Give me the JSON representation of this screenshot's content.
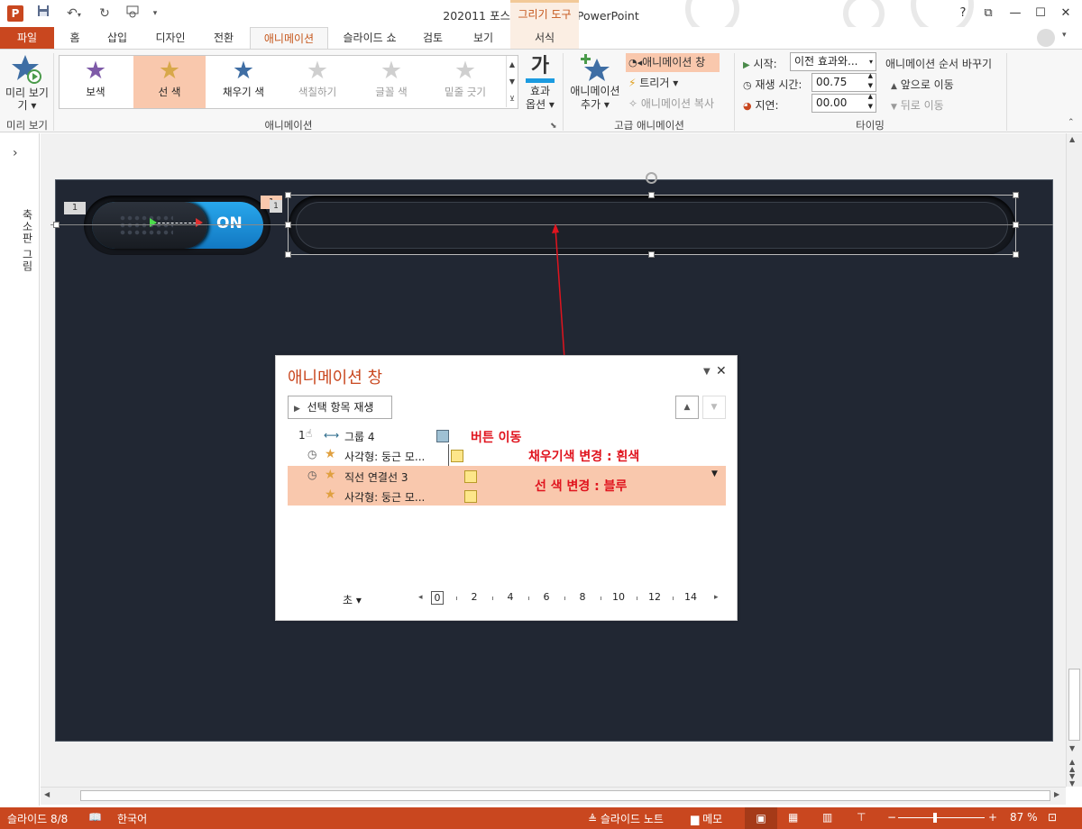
{
  "app": {
    "title": "202011 포스팅용 완성본 - PowerPoint",
    "context_tab_group": "그리기 도구",
    "brand_color": "#c9471f",
    "accent_color": "#f9c8ad"
  },
  "qat": {
    "powerpoint_icon": "P",
    "save_icon": "floppy-icon",
    "undo_icon": "undo-icon",
    "redo_icon": "redo-icon",
    "present_icon": "present-icon"
  },
  "window": {
    "help": "?",
    "restore_ribbon": "⧉",
    "minimize": "—",
    "maximize": "☐",
    "close": "✕"
  },
  "tabs": {
    "file": "파일",
    "home": "홈",
    "insert": "삽입",
    "design": "디자인",
    "transitions": "전환",
    "animations": "애니메이션",
    "slideshow": "슬라이드 쇼",
    "review": "검토",
    "view": "보기",
    "format": "서식"
  },
  "ribbon": {
    "preview": {
      "label": "미리 보기",
      "label_line2": "기 ▾",
      "group": "미리 보기"
    },
    "animation_gallery": {
      "items": [
        {
          "label": "보색",
          "star_color": "#7e5aa8",
          "disabled": false
        },
        {
          "label": "선 색",
          "star_color": "#d8a84a",
          "disabled": false,
          "selected": true
        },
        {
          "label": "채우기 색",
          "star_color": "#3f6ea4",
          "disabled": false
        },
        {
          "label": "색칠하기",
          "star_color": "#cfcfcf",
          "disabled": true
        },
        {
          "label": "글꼴 색",
          "star_color": "#cfcfcf",
          "disabled": true
        },
        {
          "label": "밑줄 긋기",
          "star_color": "#cfcfcf",
          "disabled": true
        }
      ],
      "group": "애니메이션"
    },
    "effect_options": {
      "glyph": "가",
      "label1": "효과",
      "label2": "옵션 ▾"
    },
    "advanced": {
      "add_label1": "애니메이션",
      "add_label2": "추가 ▾",
      "pane": "애니메이션 창",
      "trigger": "트리거 ▾",
      "painter": "애니메이션 복사",
      "group": "고급 애니메이션"
    },
    "timing": {
      "start_label": "시작:",
      "start_value": "이전 효과와...",
      "duration_label": "재생 시간:",
      "duration_value": "00.75",
      "delay_label": "지연:",
      "delay_value": "00.00",
      "reorder_title": "애니메이션 순서 바꾸기",
      "move_earlier": "앞으로 이동",
      "move_later": "뒤로 이동",
      "group": "타이밍"
    }
  },
  "left_pane": {
    "label": "축소판 그림",
    "expand": "›"
  },
  "slide": {
    "toggle_label": "ON",
    "anim_tag_1": "1",
    "anim_tag_2": "1",
    "anim_tag_3": "1"
  },
  "animation_pane": {
    "title": "애니메이션 창",
    "play_button": "선택 항목 재생",
    "items": [
      {
        "index": "1",
        "name": "그룹 4",
        "annotation": "버튼 이동"
      },
      {
        "name": "사각형: 둥근 모...",
        "annotation": "채우기색 변경 : 흰색"
      },
      {
        "name": "직선 연결선 3",
        "annotation": "선 색 변경 : 블루"
      },
      {
        "name": "사각형: 둥근 모..."
      }
    ],
    "timeline": {
      "unit": "초 ▾",
      "ticks": [
        "0",
        "2",
        "4",
        "6",
        "8",
        "10",
        "12",
        "14"
      ]
    }
  },
  "status": {
    "slide": "슬라이드 8/8",
    "language": "한국어",
    "notes": "슬라이드 노트",
    "comments": "메모",
    "zoom": "87 %",
    "zoom_level": 0.87
  }
}
